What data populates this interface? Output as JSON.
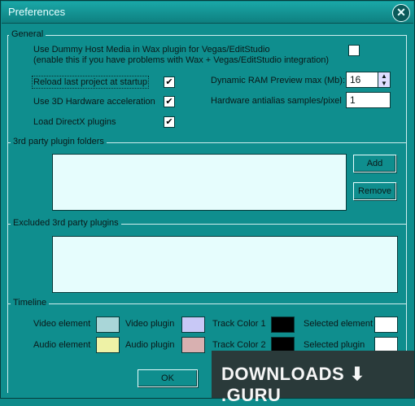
{
  "window": {
    "title": "Preferences",
    "close_icon": "close-icon"
  },
  "general": {
    "section": "General",
    "dummy_line1": "Use Dummy Host Media in Wax plugin for Vegas/EditStudio",
    "dummy_line2": "(enable this if you have problems with Wax + Vegas/EditStudio integration)",
    "dummy_checked": false,
    "reload": "Reload last project at startup",
    "reload_checked": true,
    "hw3d": "Use 3D Hardware acceleration",
    "hw3d_checked": true,
    "directx": "Load DirectX plugins",
    "directx_checked": true,
    "ram_label": "Dynamic RAM Preview max (Mb):",
    "ram_value": "16",
    "aa_label": "Hardware antialias samples/pixel",
    "aa_value": "1",
    "check_mark": "✔"
  },
  "folders": {
    "section": "3rd party plugin folders",
    "add": "Add",
    "remove": "Remove"
  },
  "excluded": {
    "section": "Excluded 3rd party plugins"
  },
  "timeline": {
    "section": "Timeline",
    "video_element": "Video element",
    "video_plugin": "Video plugin",
    "track1": "Track Color 1",
    "selected_element": "Selected element",
    "audio_element": "Audio element",
    "audio_plugin": "Audio plugin",
    "track2": "Track Color 2",
    "selected_plugin": "Selected plugin",
    "colors": {
      "video_element": "#a9d6d8",
      "video_plugin": "#c8c8f6",
      "track1": "#000000",
      "selected_element": "#ffffff",
      "audio_element": "#eef2a6",
      "audio_plugin": "#d8b0b0",
      "track2": "#000000",
      "selected_plugin": "#ffffff"
    }
  },
  "buttons": {
    "ok": "OK"
  },
  "watermark": "DOWNLOADS ⬇ .GURU"
}
